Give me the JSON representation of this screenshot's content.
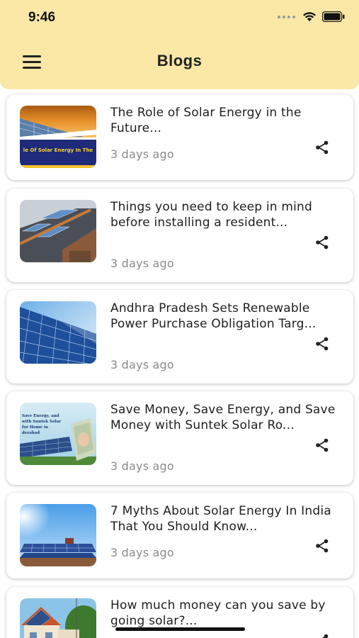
{
  "status_bar": {
    "time": "9:46"
  },
  "header": {
    "title": "Blogs",
    "menu_icon": "hamburger-menu-icon"
  },
  "posts": [
    {
      "title": "The Role of Solar Energy in the Future...",
      "time": "3 days ago",
      "thumb_caption": "le Of Solar Energy In The"
    },
    {
      "title": "Things you need to keep in mind before installing a resident...",
      "time": "3 days ago"
    },
    {
      "title": "Andhra Pradesh Sets Renewable Power Purchase Obligation Targ...",
      "time": "3 days ago"
    },
    {
      "title": "Save Money, Save Energy, and Save Money with Suntek Solar Ro...",
      "time": "3 days ago",
      "thumb_caption_lines": [
        "Save Energy, and",
        "with Suntek Solar",
        "for Home in",
        "derabad"
      ]
    },
    {
      "title": "7 Myths About Solar Energy In India That You Should Know...",
      "time": "3 days ago"
    },
    {
      "title": "How much money can you save by going solar?...",
      "time": ""
    }
  ],
  "colors": {
    "header_bg": "#fbe8a6",
    "time_text": "#8a8a8a",
    "card_bg": "#ffffff"
  },
  "icons": {
    "share": "share-icon"
  }
}
